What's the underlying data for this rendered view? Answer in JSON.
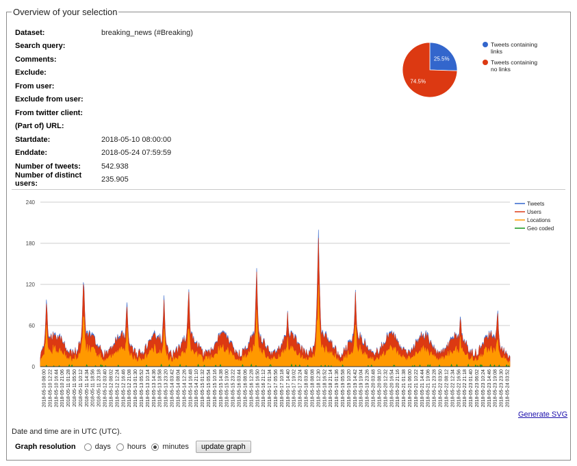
{
  "section_title": "Overview of your selection",
  "info": {
    "dataset_label": "Dataset:",
    "dataset_value": "breaking_news (#Breaking)",
    "search_label": "Search query:",
    "comments_label": "Comments:",
    "exclude_label": "Exclude:",
    "from_user_label": "From user:",
    "exclude_user_label": "Exclude from user:",
    "client_label": "From twitter client:",
    "url_label": "(Part of) URL:",
    "start_label": "Startdate:",
    "start_value": "2018-05-10 08:00:00",
    "end_label": "Enddate:",
    "end_value": "2018-05-24 07:59:59",
    "tweets_label": "Number of tweets:",
    "tweets_value": "542.938",
    "users_label": "Number of distinct users:",
    "users_value": "235.905"
  },
  "pie": {
    "slices": [
      {
        "name": "Tweets containing links",
        "pct": 25.5,
        "label": "25.5%",
        "color": "#3366cc"
      },
      {
        "name": "Tweets containing no links",
        "pct": 74.5,
        "label": "74.5%",
        "color": "#dc3912"
      }
    ]
  },
  "chart_data": {
    "type": "line",
    "ylim": [
      0,
      240
    ],
    "yticks": [
      0,
      60,
      120,
      180,
      240
    ],
    "grid": true,
    "legend_position": "top-right",
    "series": [
      {
        "name": "Tweets",
        "color": "#3366cc"
      },
      {
        "name": "Users",
        "color": "#dc3912"
      },
      {
        "name": "Locations",
        "color": "#ff9900"
      },
      {
        "name": "Geo coded",
        "color": "#109618"
      }
    ],
    "x_ticks": [
      "2018-05-10 08:00",
      "2018-05-10 12:22",
      "2018-05-10 16:44",
      "2018-05-10 21:06",
      "2018-05-11 01:28",
      "2018-05-11 05:50",
      "2018-05-11 10:12",
      "2018-05-11 14:34",
      "2018-05-11 18:56",
      "2018-05-11 23:18",
      "2018-05-12 03:40",
      "2018-05-12 08:02",
      "2018-05-12 12:24",
      "2018-05-12 16:46",
      "2018-05-12 21:08",
      "2018-05-13 01:30",
      "2018-05-13 05:52",
      "2018-05-13 10:14",
      "2018-05-13 14:36",
      "2018-05-13 18:58",
      "2018-05-13 23:20",
      "2018-05-14 03:42",
      "2018-05-14 08:04",
      "2018-05-14 12:26",
      "2018-05-14 16:48",
      "2018-05-14 21:10",
      "2018-05-15 01:32",
      "2018-05-15 05:54",
      "2018-05-15 10:16",
      "2018-05-15 14:38",
      "2018-05-15 19:00",
      "2018-05-15 23:22",
      "2018-05-16 03:44",
      "2018-05-16 08:06",
      "2018-05-16 12:28",
      "2018-05-16 16:50",
      "2018-05-16 21:12",
      "2018-05-17 01:34",
      "2018-05-17 05:56",
      "2018-05-17 10:18",
      "2018-05-17 14:40",
      "2018-05-17 19:02",
      "2018-05-17 23:24",
      "2018-05-18 03:46",
      "2018-05-18 08:08",
      "2018-05-18 12:30",
      "2018-05-18 16:52",
      "2018-05-18 21:14",
      "2018-05-19 01:36",
      "2018-05-19 05:58",
      "2018-05-19 10:20",
      "2018-05-19 14:42",
      "2018-05-19 19:04",
      "2018-05-19 23:26",
      "2018-05-20 03:48",
      "2018-05-20 08:10",
      "2018-05-20 12:32",
      "2018-05-20 16:54",
      "2018-05-20 21:16",
      "2018-05-21 01:38",
      "2018-05-21 06:00",
      "2018-05-21 10:22",
      "2018-05-21 14:44",
      "2018-05-21 19:06",
      "2018-05-21 23:28",
      "2018-05-22 03:50",
      "2018-05-22 08:12",
      "2018-05-22 12:34",
      "2018-05-22 16:56",
      "2018-05-22 21:18",
      "2018-05-23 01:40",
      "2018-05-23 06:02",
      "2018-05-23 10:24",
      "2018-05-23 14:46",
      "2018-05-23 19:08",
      "2018-05-23 23:30",
      "2018-05-24 03:52"
    ],
    "peaks": [
      {
        "x": "2018-05-10 12:22",
        "tweets": 102,
        "users": 100
      },
      {
        "x": "2018-05-11 14:34",
        "tweets": 140,
        "users": 138
      },
      {
        "x": "2018-05-12 21:08",
        "tweets": 99,
        "users": 98
      },
      {
        "x": "2018-05-13 23:20",
        "tweets": 100,
        "users": 97
      },
      {
        "x": "2018-05-14 16:48",
        "tweets": 118,
        "users": 117
      },
      {
        "x": "2018-05-16 16:50",
        "tweets": 146,
        "users": 144
      },
      {
        "x": "2018-05-17 14:40",
        "tweets": 80,
        "users": 79
      },
      {
        "x": "2018-05-18 12:30",
        "tweets": 205,
        "users": 200
      },
      {
        "x": "2018-05-19 14:42",
        "tweets": 112,
        "users": 110
      },
      {
        "x": "2018-05-22 16:56",
        "tweets": 79,
        "users": 77
      },
      {
        "x": "2018-05-23 19:08",
        "tweets": 88,
        "users": 85
      }
    ]
  },
  "generate_svg": "Generate SVG",
  "timezone_note": "Date and time are in UTC (UTC).",
  "resolution": {
    "label": "Graph resolution",
    "options": [
      "days",
      "hours",
      "minutes"
    ],
    "selected": "minutes",
    "button": "update graph"
  }
}
